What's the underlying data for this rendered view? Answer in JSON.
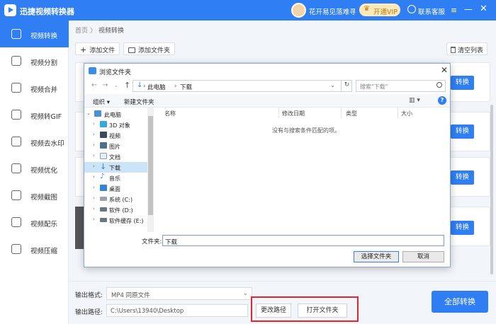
{
  "titlebar": {
    "app_title": "迅捷视频转换器",
    "username": "花开易见落难寻",
    "vip_label": "开通VIP",
    "support_label": "联系客服",
    "menu_glyph": "≡",
    "minimize_glyph": "—",
    "close_glyph": "✕"
  },
  "sidebar": {
    "items": [
      {
        "label": "视频转换",
        "icon": "video-convert-icon",
        "active": true
      },
      {
        "label": "视频分割",
        "icon": "split-icon"
      },
      {
        "label": "视频合并",
        "icon": "merge-icon"
      },
      {
        "label": "视频转GIF",
        "icon": "gif-icon"
      },
      {
        "label": "视频去水印",
        "icon": "watermark-icon"
      },
      {
        "label": "视频优化",
        "icon": "optimize-icon"
      },
      {
        "label": "视频截图",
        "icon": "screenshot-icon"
      },
      {
        "label": "视频配乐",
        "icon": "music-icon"
      },
      {
        "label": "视频压缩",
        "icon": "compress-icon"
      }
    ]
  },
  "breadcrumb": {
    "home": "首页",
    "separator": "〉",
    "current": "视频转换"
  },
  "toolbar": {
    "add_file": "添加文件",
    "add_folder": "添加文件夹",
    "clear_list": "清空列表"
  },
  "file_rows": {
    "convert_label": "转换"
  },
  "bottom": {
    "format_label": "输出格式:",
    "format_value": "MP4  同原文件",
    "path_label": "输出路径:",
    "path_value": "C:\\Users\\13940\\Desktop",
    "change_path": "更改路径",
    "open_folder": "打开文件夹",
    "convert_all": "全部转换"
  },
  "dialog": {
    "title": "浏览文件夹",
    "address_segments": [
      "此电脑",
      "下载"
    ],
    "search_placeholder": "搜索\"下载\"",
    "organize": "组织 ▾",
    "new_folder": "新建文件夹",
    "help": "?",
    "tree": [
      {
        "label": "此电脑",
        "level": 0,
        "expanded": true,
        "icon": "pc-icon"
      },
      {
        "label": "3D 对象",
        "level": 1,
        "icon": "3d-objects-icon"
      },
      {
        "label": "视频",
        "level": 1,
        "icon": "videos-folder-icon"
      },
      {
        "label": "图片",
        "level": 1,
        "icon": "pictures-folder-icon"
      },
      {
        "label": "文档",
        "level": 1,
        "icon": "documents-folder-icon"
      },
      {
        "label": "下载",
        "level": 1,
        "icon": "downloads-folder-icon",
        "selected": true
      },
      {
        "label": "音乐",
        "level": 1,
        "icon": "music-folder-icon"
      },
      {
        "label": "桌面",
        "level": 1,
        "icon": "desktop-folder-icon"
      },
      {
        "label": "系统 (C:)",
        "level": 1,
        "icon": "drive-icon"
      },
      {
        "label": "软件 (D:)",
        "level": 1,
        "icon": "drive-icon"
      },
      {
        "label": "软件缓存 (E:)",
        "level": 1,
        "icon": "drive-icon"
      }
    ],
    "columns": [
      "名称",
      "修改日期",
      "类型",
      "大小"
    ],
    "empty_message": "没有与搜索条件匹配的项。",
    "folder_label": "文件夹:",
    "folder_value": "下载",
    "select_button": "选择文件夹",
    "cancel_button": "取消"
  },
  "colors": {
    "accent": "#2f7ef3",
    "highlight": "#e8262a"
  }
}
